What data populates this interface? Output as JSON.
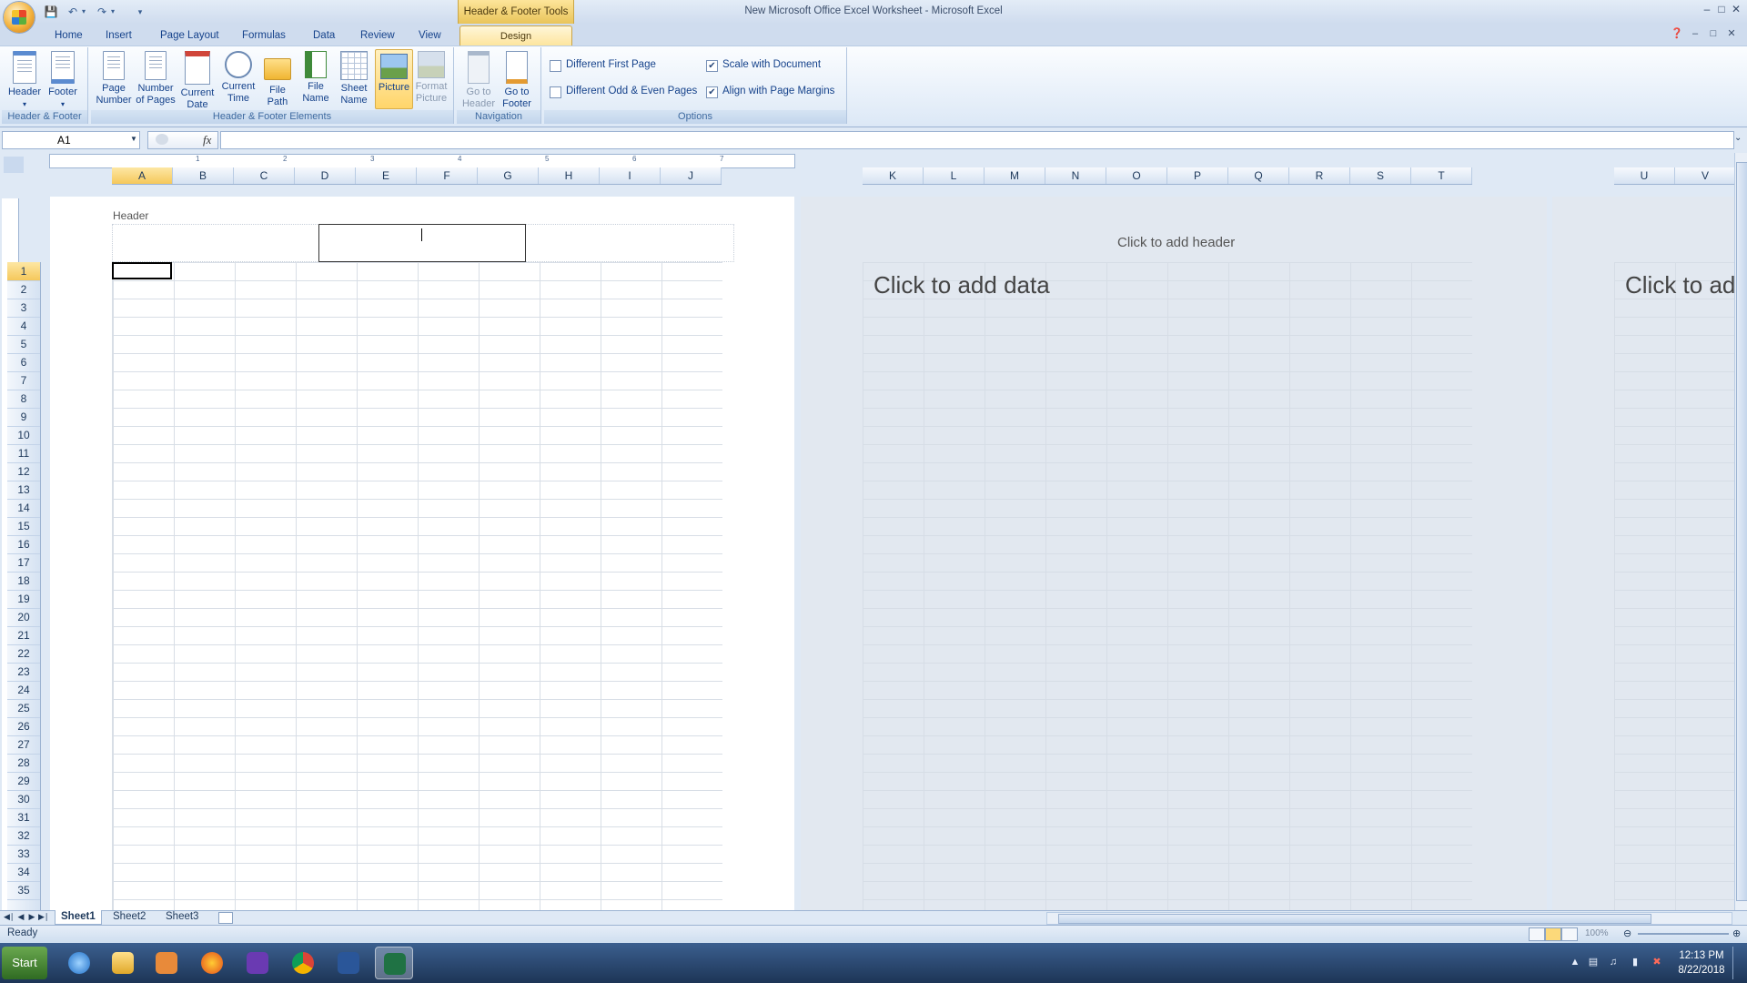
{
  "window": {
    "title": "New Microsoft Office Excel Worksheet - Microsoft Excel",
    "contextual_group": "Header & Footer Tools"
  },
  "ribbon": {
    "tabs": [
      "Home",
      "Insert",
      "Page Layout",
      "Formulas",
      "Data",
      "Review",
      "View"
    ],
    "active_tab": "Design",
    "groups": {
      "header_footer": {
        "label": "Header & Footer",
        "header_btn": "Header",
        "footer_btn": "Footer"
      },
      "elements": {
        "label": "Header & Footer Elements",
        "page_number": [
          "Page",
          "Number"
        ],
        "number_of_pages": [
          "Number",
          "of Pages"
        ],
        "current_date": [
          "Current",
          "Date"
        ],
        "current_time": [
          "Current",
          "Time"
        ],
        "file_path": [
          "File",
          "Path"
        ],
        "file_name": [
          "File",
          "Name"
        ],
        "sheet_name": [
          "Sheet",
          "Name"
        ],
        "picture": "Picture",
        "format_picture": [
          "Format",
          "Picture"
        ]
      },
      "navigation": {
        "label": "Navigation",
        "go_to_header": [
          "Go to",
          "Header"
        ],
        "go_to_footer": [
          "Go to",
          "Footer"
        ]
      },
      "options": {
        "label": "Options",
        "different_first_page": "Different First Page",
        "different_odd_even": "Different Odd & Even Pages",
        "scale_with_document": "Scale with Document",
        "align_with_margins": "Align with Page Margins",
        "checked": {
          "different_first_page": false,
          "different_odd_even": false,
          "scale_with_document": true,
          "align_with_margins": true
        }
      }
    }
  },
  "formula_bar": {
    "name_box": "A1",
    "fx": "fx",
    "value": ""
  },
  "sheet": {
    "columns_page1": [
      "A",
      "B",
      "C",
      "D",
      "E",
      "F",
      "G",
      "H",
      "I",
      "J"
    ],
    "columns_page2": [
      "K",
      "L",
      "M",
      "N",
      "O",
      "P",
      "Q",
      "R",
      "S",
      "T"
    ],
    "columns_page3": [
      "U",
      "V"
    ],
    "rows": [
      "1",
      "2",
      "3",
      "4",
      "5",
      "6",
      "7",
      "8",
      "9",
      "10",
      "11",
      "12",
      "13",
      "14",
      "15",
      "16",
      "17",
      "18",
      "19",
      "20",
      "21",
      "22",
      "23",
      "24",
      "25",
      "26",
      "27",
      "28",
      "29",
      "30",
      "31",
      "32",
      "33",
      "34",
      "35"
    ],
    "active_column": "A",
    "active_row": "1",
    "header_label": "Header",
    "click_to_add_header": "Click to add header",
    "click_to_add_data": "Click to add data",
    "click_to_add_data_partial": "Click to add",
    "ruler_marks": [
      "1",
      "2",
      "3",
      "4",
      "5",
      "6",
      "7"
    ]
  },
  "sheet_tabs": [
    "Sheet1",
    "Sheet2",
    "Sheet3"
  ],
  "status": {
    "text": "Ready",
    "zoom": "100%"
  },
  "taskbar": {
    "start": "Start",
    "time": "12:13 PM",
    "date": "8/22/2018"
  },
  "colors": {
    "ribbon_bg": "#dce8f6",
    "accent_gold": "#f5c85b",
    "taskbar": "#1d3556"
  }
}
